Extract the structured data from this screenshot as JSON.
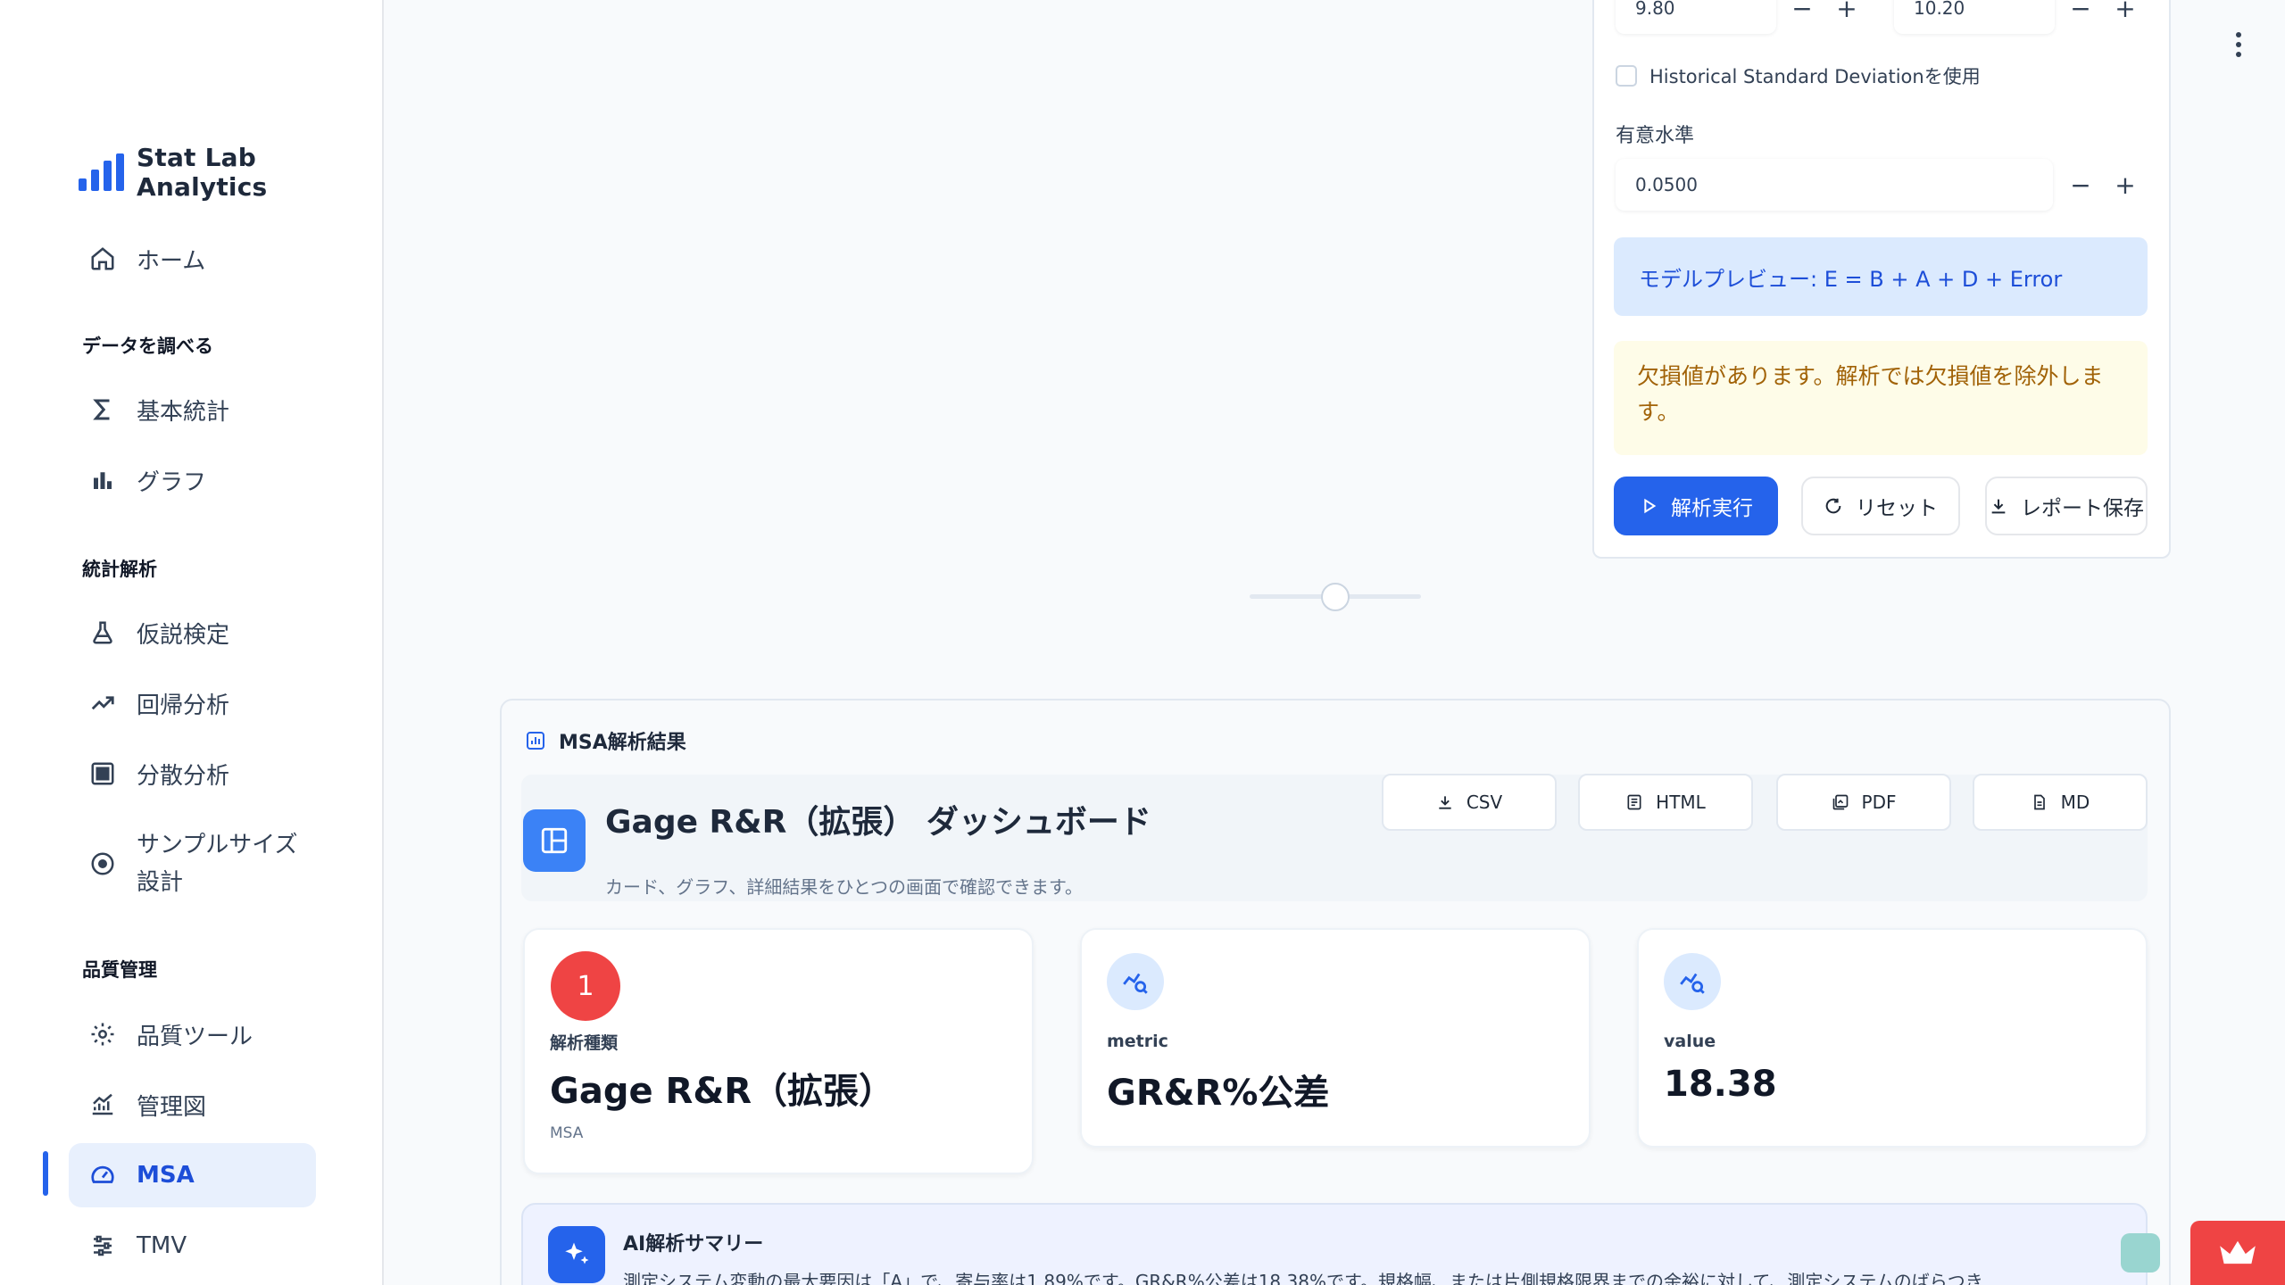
{
  "app": {
    "name": "Stat Lab Analytics",
    "accent": "#2563eb"
  },
  "sidebar": {
    "home": "ホーム",
    "sections": [
      {
        "title": "データを調べる",
        "items": [
          "基本統計",
          "グラフ"
        ]
      },
      {
        "title": "統計解析",
        "items": [
          "仮説検定",
          "回帰分析",
          "分散分析",
          "サンプルサイズ設計"
        ]
      },
      {
        "title": "品質管理",
        "items": [
          "品質ツール",
          "管理図",
          "MSA",
          "TMV"
        ]
      }
    ],
    "labels": {
      "home": "ホーム",
      "explore": "データを調べる",
      "basic_stats": "基本統計",
      "graph": "グラフ",
      "analysis": "統計解析",
      "hypothesis": "仮説検定",
      "regression": "回帰分析",
      "anova": "分散分析",
      "sample_size_1": "サンプルサイズ",
      "sample_size_2": "設計",
      "quality": "品質管理",
      "quality_tools": "品質ツール",
      "control_chart": "管理図",
      "msa": "MSA",
      "tmv": "TMV"
    },
    "active": "MSA"
  },
  "settings": {
    "lower_spec": "9.80",
    "upper_spec": "10.20",
    "historical_sd_label": "Historical Standard Deviationを使用",
    "historical_sd_checked": false,
    "significance_label": "有意水準",
    "significance_value": "0.0500",
    "model_preview": "モデルプレビュー: E = B + A + D + Error",
    "missing_warning": "欠損値があります。解析では欠損値を除外します。",
    "run_label": "解析実行",
    "reset_label": "リセット",
    "save_label": "レポート保存",
    "minus": "−",
    "plus": "+"
  },
  "slider": {
    "value": 0.5
  },
  "results": {
    "section_title": "MSA解析結果",
    "dashboard_title": "Gage R&R（拡張） ダッシュボード",
    "dashboard_subtitle": "カード、グラフ、詳細結果をひとつの画面で確認できます。",
    "exports": [
      "CSV",
      "HTML",
      "PDF",
      "MD"
    ],
    "cards": [
      {
        "badge": "1",
        "label": "解析種類",
        "value": "Gage R&R（拡張）",
        "foot": "MSA"
      },
      {
        "icon": "chart-search-icon",
        "label": "metric",
        "value": "GR&R%公差"
      },
      {
        "icon": "chart-search-icon",
        "label": "value",
        "value": "18.38"
      }
    ],
    "ai_summary": {
      "title": "AI解析サマリー",
      "text": "測定システム変動の最大要因は「A」で、寄与率は1.89%です。GR&R%公差は18.38%です。規格幅、または片側規格限界までの余裕に対して、測定システムのばらつき"
    }
  }
}
